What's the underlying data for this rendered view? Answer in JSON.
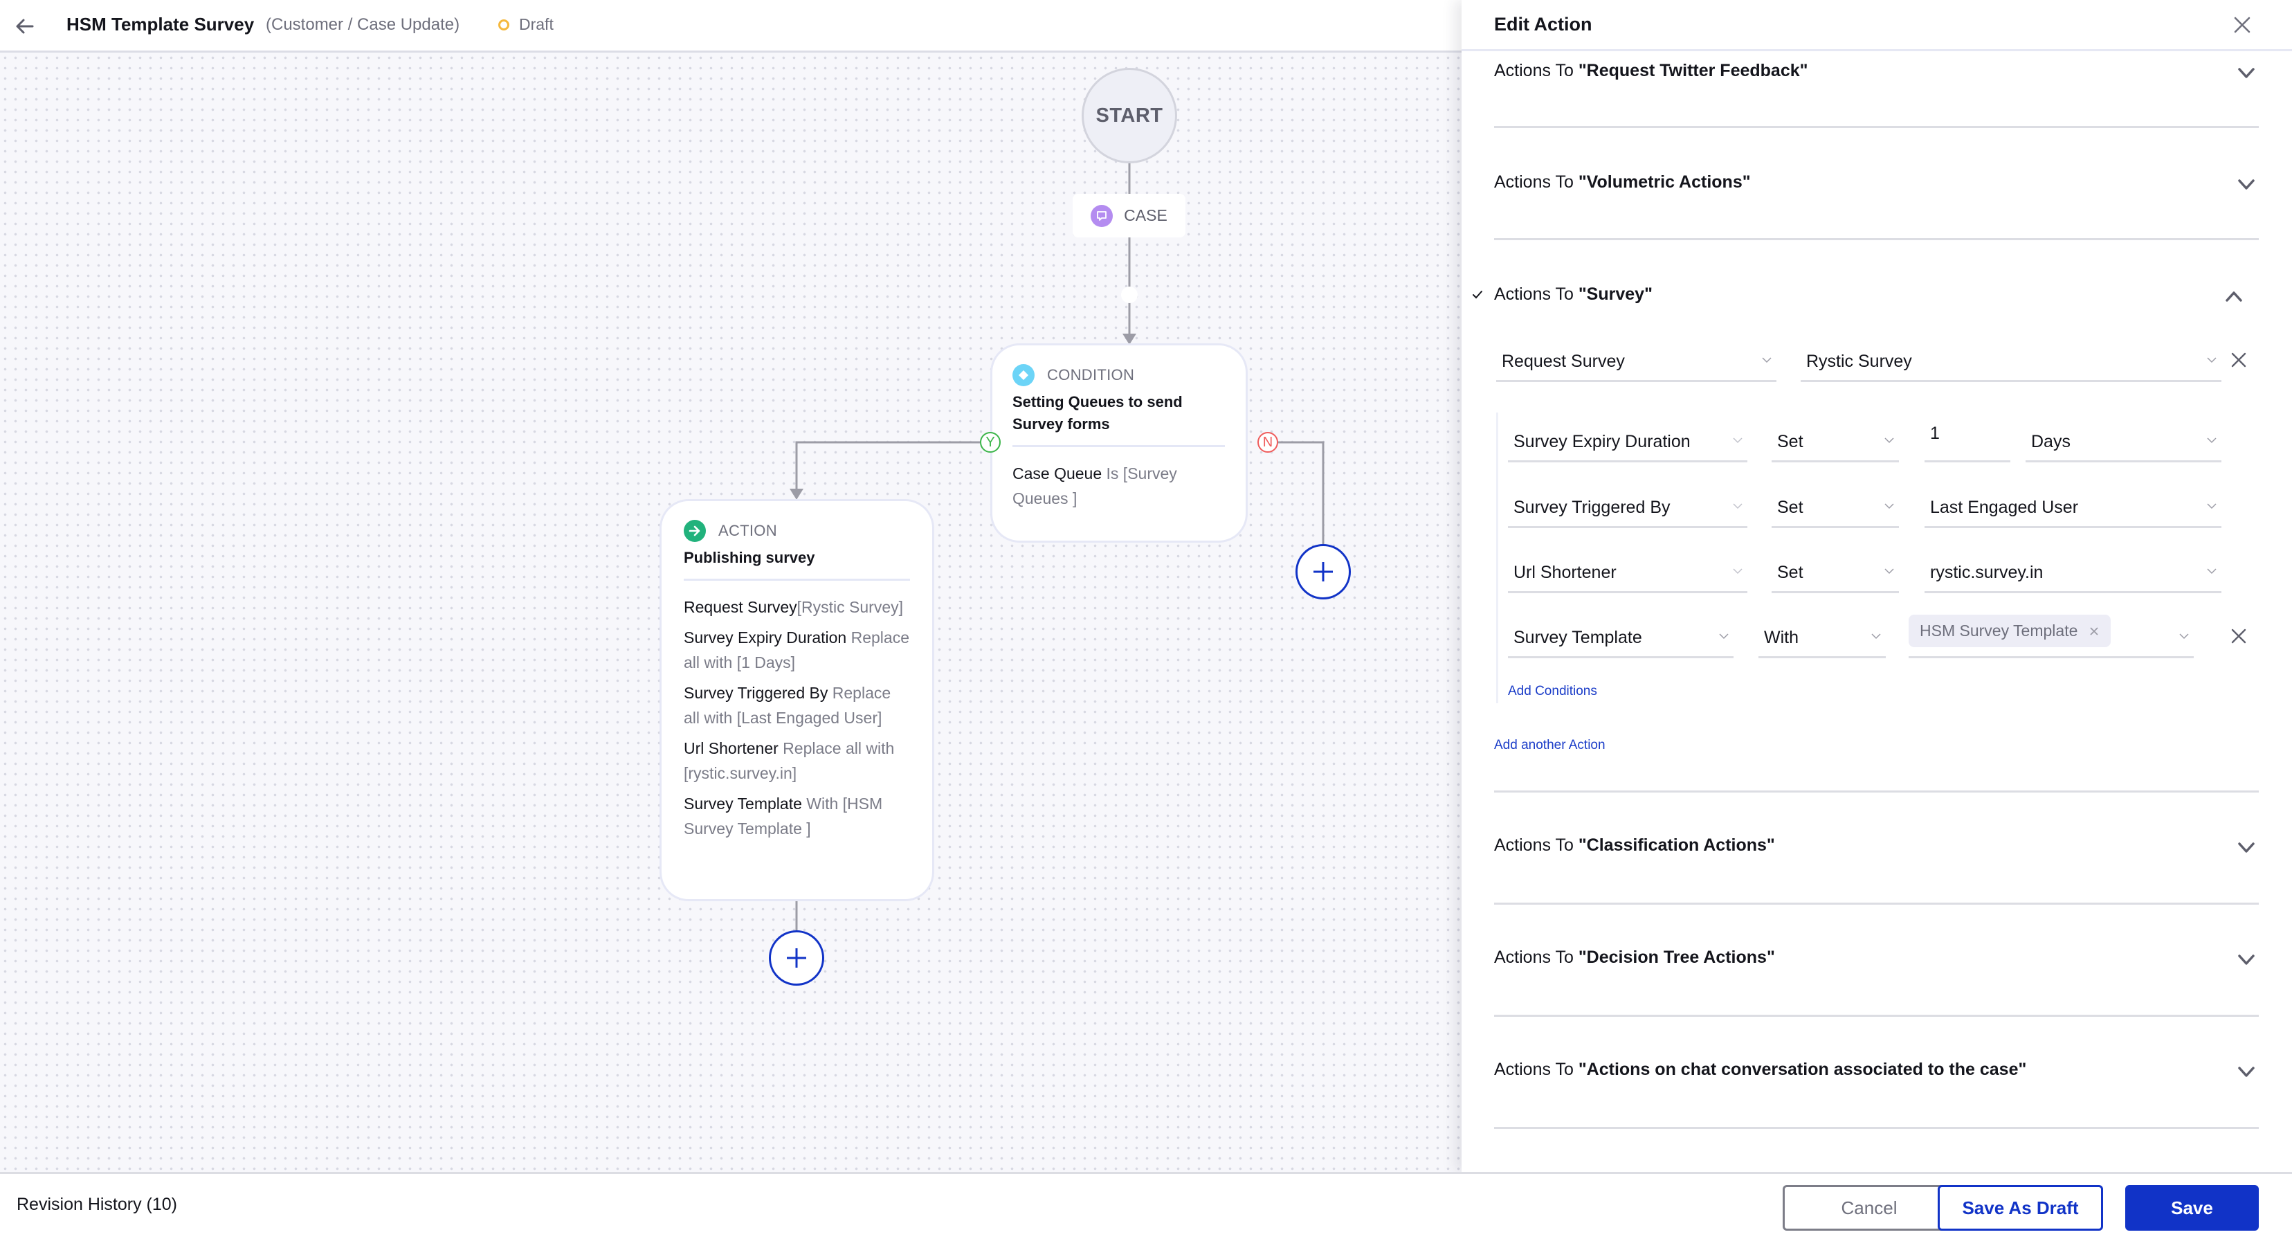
{
  "header": {
    "title": "HSM Template Survey",
    "subtitle": "(Customer / Case Update)",
    "status": "Draft",
    "status_color": "#f5b83d"
  },
  "canvas": {
    "start_label": "START",
    "case_label": "CASE",
    "condition": {
      "type_label": "CONDITION",
      "title": "Setting Queues to send Survey forms",
      "rule_field": "Case Queue",
      "rule_value": "Is [Survey Queues ]",
      "yes_port": "Y",
      "no_port": "N"
    },
    "action": {
      "type_label": "ACTION",
      "title": "Publishing survey",
      "lines": [
        {
          "field": "Request Survey",
          "value": "[Rystic Survey]"
        },
        {
          "field": "Survey Expiry Duration",
          "value": "Replace all with [1 Days]"
        },
        {
          "field": "Survey Triggered By",
          "value": "Replace all with [Last Engaged User]"
        },
        {
          "field": "Url Shortener",
          "value": "Replace all with [rystic.survey.in]"
        },
        {
          "field": "Survey Template",
          "value": "With [HSM Survey Template ]"
        }
      ]
    }
  },
  "panel": {
    "title": "Edit Action",
    "sections": [
      {
        "prefix": "Actions To ",
        "name": "\"Request Twitter Feedback\"",
        "expanded": false
      },
      {
        "prefix": "Actions To ",
        "name": "\"Volumetric Actions\"",
        "expanded": false
      },
      {
        "prefix": "Actions To ",
        "name": "\"Survey\"",
        "expanded": true,
        "checked": true
      },
      {
        "prefix": "Actions To ",
        "name": "\"Classification Actions\"",
        "expanded": false
      },
      {
        "prefix": "Actions To ",
        "name": "\"Decision Tree Actions\"",
        "expanded": false
      },
      {
        "prefix": "Actions To ",
        "name": "\"Actions on chat conversation associated to the case\"",
        "expanded": false
      }
    ],
    "survey": {
      "action_type": "Request Survey",
      "action_value": "Rystic Survey",
      "conditions": [
        {
          "field": "Survey Expiry Duration",
          "operator": "Set",
          "value": "1",
          "unit": "Days"
        },
        {
          "field": "Survey Triggered By",
          "operator": "Set",
          "value": "Last Engaged User"
        },
        {
          "field": "Url Shortener",
          "operator": "Set",
          "value": "rystic.survey.in"
        },
        {
          "field": "Survey Template",
          "operator": "With",
          "tags": [
            "HSM Survey Template"
          ]
        }
      ],
      "add_conditions": "Add Conditions",
      "add_another_action": "Add another Action"
    }
  },
  "footer": {
    "revision_history": "Revision History (10)",
    "cancel": "Cancel",
    "save_as_draft": "Save As Draft",
    "save": "Save",
    "primary_color": "#1133c7"
  }
}
